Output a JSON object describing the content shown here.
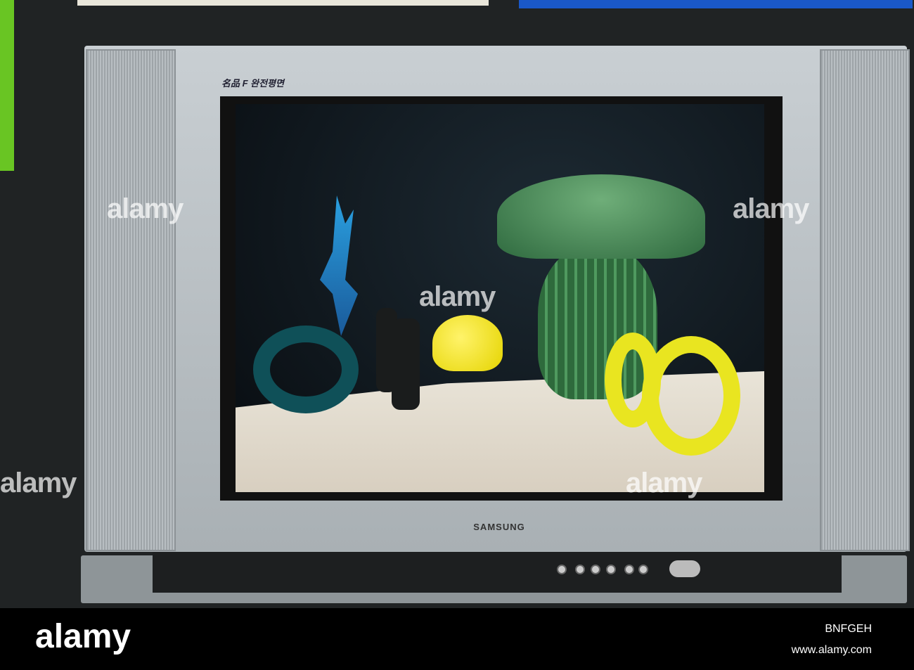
{
  "tv": {
    "panel_logo": "名品 F 완전평면",
    "brand": "SAMSUNG"
  },
  "watermark": {
    "text": "alamy"
  },
  "footer": {
    "logo": "alamy",
    "image_id": "BNFGEH",
    "url": "www.alamy.com"
  },
  "colors": {
    "tv_frame": "#b8bec2",
    "sign_blue": "#1a58c8",
    "sign_green": "#69c523"
  }
}
